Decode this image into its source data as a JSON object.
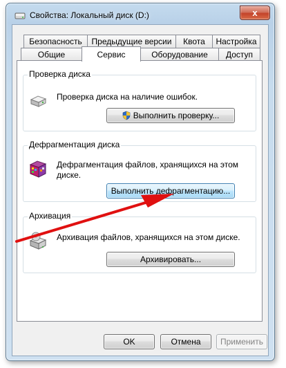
{
  "window": {
    "title": "Свойства: Локальный диск (D:)",
    "close_label": "x"
  },
  "tabs": {
    "row1": [
      "Безопасность",
      "Предыдущие версии",
      "Квота",
      "Настройка"
    ],
    "row2": [
      "Общие",
      "Сервис",
      "Оборудование",
      "Доступ"
    ],
    "active": "Сервис"
  },
  "groups": {
    "check": {
      "title": "Проверка диска",
      "description": "Проверка диска на наличие ошибок.",
      "button": "Выполнить проверку..."
    },
    "defrag": {
      "title": "Дефрагментация диска",
      "description_line1": "Дефрагментация файлов, хранящихся на этом",
      "description_line2": "диске.",
      "button": "Выполнить дефрагментацию..."
    },
    "backup": {
      "title": "Архивация",
      "description": "Архивация файлов, хранящихся на этом диске.",
      "button": "Архивировать..."
    }
  },
  "footer": {
    "ok": "OK",
    "cancel": "Отмена",
    "apply": "Применить"
  },
  "colors": {
    "annotation_arrow": "#e01010"
  }
}
